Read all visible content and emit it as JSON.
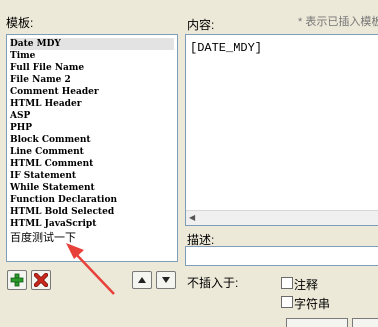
{
  "left_panel": {
    "label": "模板:"
  },
  "right_panel": {
    "label": "内容:",
    "hint": "* 表示已插入模板"
  },
  "templates": [
    {
      "label": "Date MDY",
      "selected": true
    },
    {
      "label": "Time"
    },
    {
      "label": "Full File Name"
    },
    {
      "label": "File Name 2"
    },
    {
      "label": "Comment Header"
    },
    {
      "label": "HTML Header"
    },
    {
      "label": "ASP"
    },
    {
      "label": "PHP"
    },
    {
      "label": "Block Comment"
    },
    {
      "label": "Line Comment"
    },
    {
      "label": "HTML Comment"
    },
    {
      "label": "IF Statement"
    },
    {
      "label": "While Statement"
    },
    {
      "label": "Function Declaration"
    },
    {
      "label": "HTML Bold Selected"
    },
    {
      "label": "HTML JavaScript"
    },
    {
      "label": "百度测试一下"
    }
  ],
  "content": {
    "text": "[DATE_MDY]"
  },
  "description": {
    "label": "描述:",
    "value": ""
  },
  "exclude": {
    "label": "不插入于:",
    "options": [
      {
        "label": "注释",
        "checked": false
      },
      {
        "label": "字符串",
        "checked": false
      }
    ]
  },
  "icons": {
    "add": "plus-icon",
    "delete": "x-icon",
    "up": "arrow-up-icon",
    "down": "arrow-down-icon",
    "scroll_left": "scroll-left-arrow-icon"
  },
  "colors": {
    "add": "#2a9a2a",
    "delete": "#c8281e",
    "annotation_arrow": "#e8403a"
  }
}
